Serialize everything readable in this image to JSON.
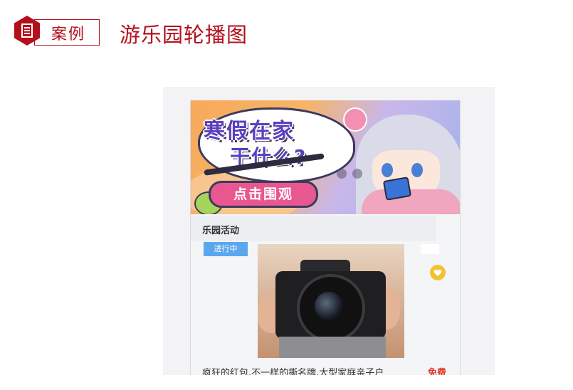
{
  "header": {
    "tag_label": "案例",
    "title": "游乐园轮播图",
    "accent_color": "#b3101c",
    "tag_icon": "document-icon"
  },
  "banner": {
    "headline": "寒假在家",
    "subline": "干什么?",
    "cta_label": "点击围观"
  },
  "card": {
    "title": "乐园活动",
    "status": "进行中",
    "favorite_icon": "heart-icon",
    "caption": "疯狂的红包,不一样的撕名牌,大型家庭亲子户",
    "price": "免费"
  }
}
